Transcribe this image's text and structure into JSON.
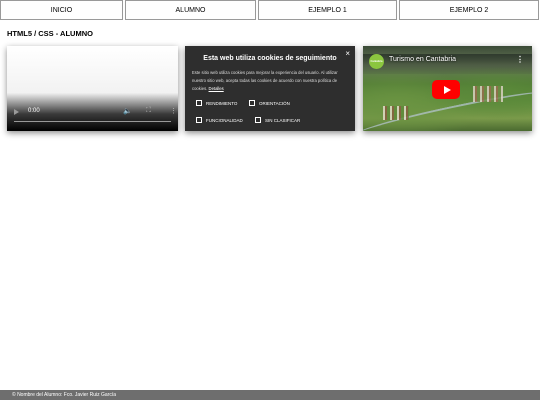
{
  "nav": {
    "items": [
      {
        "label": "INICIO"
      },
      {
        "label": "ALUMNO"
      },
      {
        "label": "EJEMPLO 1"
      },
      {
        "label": "EJEMPLO 2"
      }
    ]
  },
  "page": {
    "title": "HTML5 / CSS - ALUMNO"
  },
  "video": {
    "current_time": "0:00",
    "play_icon": "play-icon",
    "volume_icon": "volume-icon",
    "fullscreen_icon": "fullscreen-icon",
    "more_icon": "more-options-icon"
  },
  "cookie_banner": {
    "title": "Esta web utiliza cookies de seguimiento",
    "description": "Este sitio web utiliza cookies para mejorar la experiencia del usuario. Al utilizar nuestro sitio web, acepta todas las cookies de acuerdo con nuestra política de cookies.",
    "details_link": "Detalles",
    "close_label": "×",
    "options": [
      {
        "label": "RENDIMIENTO",
        "checked": false
      },
      {
        "label": "ORIENTACIÓN",
        "checked": false
      },
      {
        "label": "FUNCIONALIDAD",
        "checked": false
      },
      {
        "label": "SIN CLASIFICAR",
        "checked": false
      }
    ]
  },
  "youtube": {
    "channel_logo_text": "Cantabria",
    "title": "Turismo en Cantabria",
    "menu_label": "⋮",
    "play_color": "#ff0000"
  },
  "footer": {
    "text": "© Nombre del Alumno: Fco. Javier Ruiz García"
  }
}
